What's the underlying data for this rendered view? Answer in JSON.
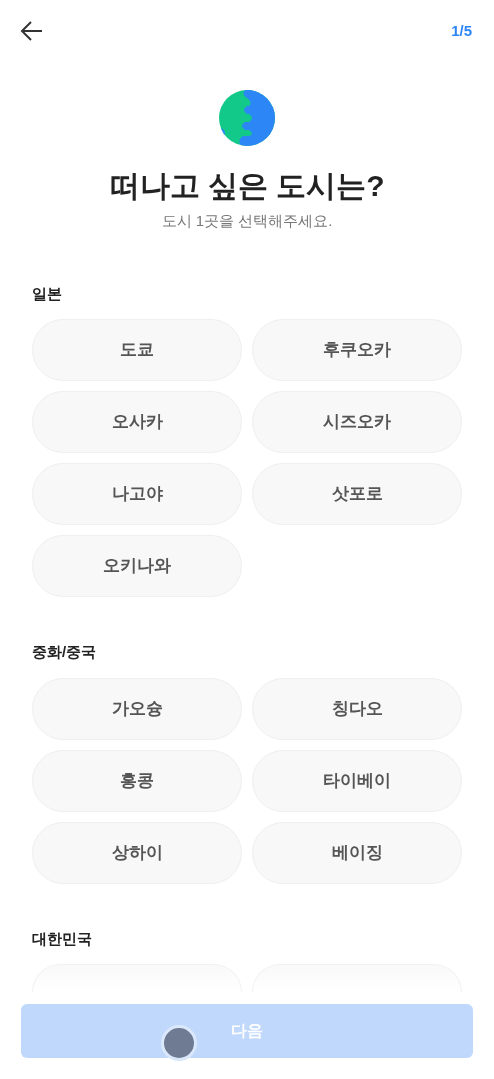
{
  "header": {
    "step": "1/5"
  },
  "title": "떠나고 싶은 도시는?",
  "subtitle": "도시 1곳을 선택해주세요.",
  "sections": [
    {
      "heading": "일본",
      "cities": [
        {
          "kind": "city",
          "label": "도쿄",
          "selected": false
        },
        {
          "kind": "city",
          "label": "후쿠오카",
          "selected": false
        },
        {
          "kind": "city",
          "label": "오사카",
          "selected": false
        },
        {
          "kind": "city",
          "label": "시즈오카",
          "selected": false
        },
        {
          "kind": "city",
          "label": "나고야",
          "selected": false
        },
        {
          "kind": "city",
          "label": "삿포로",
          "selected": false
        },
        {
          "kind": "city",
          "label": "오키나와",
          "selected": false
        }
      ]
    },
    {
      "heading": "중화/중국",
      "cities": [
        {
          "kind": "city",
          "label": "가오슝",
          "selected": false
        },
        {
          "kind": "city",
          "label": "칭다오",
          "selected": false
        },
        {
          "kind": "city",
          "label": "홍콩",
          "selected": false
        },
        {
          "kind": "city",
          "label": "타이베이",
          "selected": false
        },
        {
          "kind": "city",
          "label": "상하이",
          "selected": false
        },
        {
          "kind": "city",
          "label": "베이징",
          "selected": false
        }
      ]
    },
    {
      "heading": "대한민국",
      "cities": [
        {
          "kind": "faded"
        },
        {
          "kind": "faded"
        }
      ]
    }
  ],
  "next_button": {
    "label": "다음",
    "disabled": true
  }
}
